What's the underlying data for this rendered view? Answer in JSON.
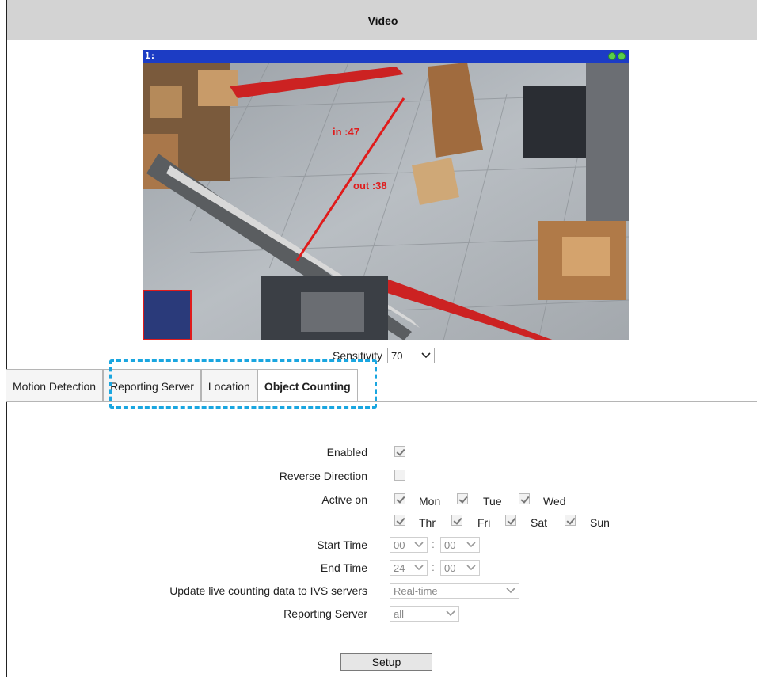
{
  "header": {
    "title": "Video"
  },
  "video": {
    "channel_label": "1:",
    "overlay_in": "in :47",
    "overlay_out": "out :38"
  },
  "sensitivity": {
    "label": "Sensitivity",
    "value": "70"
  },
  "tabs": [
    {
      "label": "Motion Detection",
      "active": false
    },
    {
      "label": "Reporting Server",
      "active": false
    },
    {
      "label": "Location",
      "active": false
    },
    {
      "label": "Object Counting",
      "active": true
    }
  ],
  "form": {
    "enabled": {
      "label": "Enabled",
      "checked": true
    },
    "reverse_direction": {
      "label": "Reverse Direction",
      "checked": false
    },
    "active_on": {
      "label": "Active on",
      "days": [
        {
          "label": "Mon",
          "checked": true
        },
        {
          "label": "Tue",
          "checked": true
        },
        {
          "label": "Wed",
          "checked": true
        },
        {
          "label": "Thr",
          "checked": true
        },
        {
          "label": "Fri",
          "checked": true
        },
        {
          "label": "Sat",
          "checked": true
        },
        {
          "label": "Sun",
          "checked": true
        }
      ]
    },
    "start_time": {
      "label": "Start Time",
      "hour": "00",
      "minute": "00"
    },
    "end_time": {
      "label": "End Time",
      "hour": "24",
      "minute": "00"
    },
    "time_separator": ":",
    "update_live": {
      "label": "Update live counting data to IVS servers",
      "value": "Real-time"
    },
    "reporting_server": {
      "label": "Reporting Server",
      "value": "all"
    },
    "setup_button": "Setup"
  },
  "colors": {
    "header_bg": "#d3d3d3",
    "video_bar": "#1c3cc4",
    "highlight": "#1aa6e0",
    "counting_line": "#e01b1b"
  },
  "icons": {
    "video_buttons": "green-dot-icon",
    "dropdown": "chevron-down-icon",
    "checkbox": "check-icon"
  }
}
